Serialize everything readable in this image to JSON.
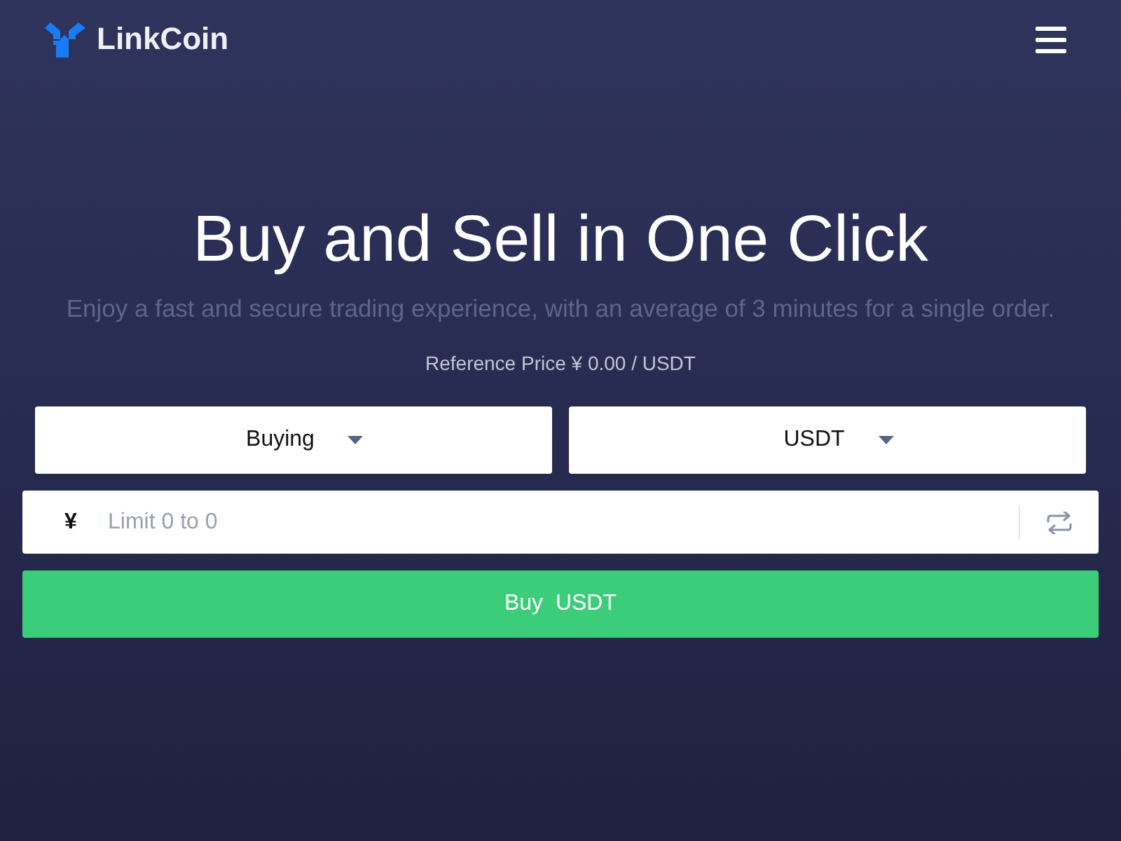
{
  "header": {
    "logo_text": "LinkCoin"
  },
  "hero": {
    "title": "Buy and Sell in One Click",
    "subtitle": "Enjoy a fast and secure trading experience, with an average of 3 minutes for a single order.",
    "reference_price": "Reference Price ¥ 0.00 / USDT"
  },
  "trade_form": {
    "selects": [
      {
        "value": "Buying"
      },
      {
        "value": "USDT"
      }
    ],
    "amount_field": {
      "prefix": "¥",
      "placeholder": "Limit 0 to 0"
    },
    "submit_button": {
      "label": "Buy  USDT"
    }
  }
}
